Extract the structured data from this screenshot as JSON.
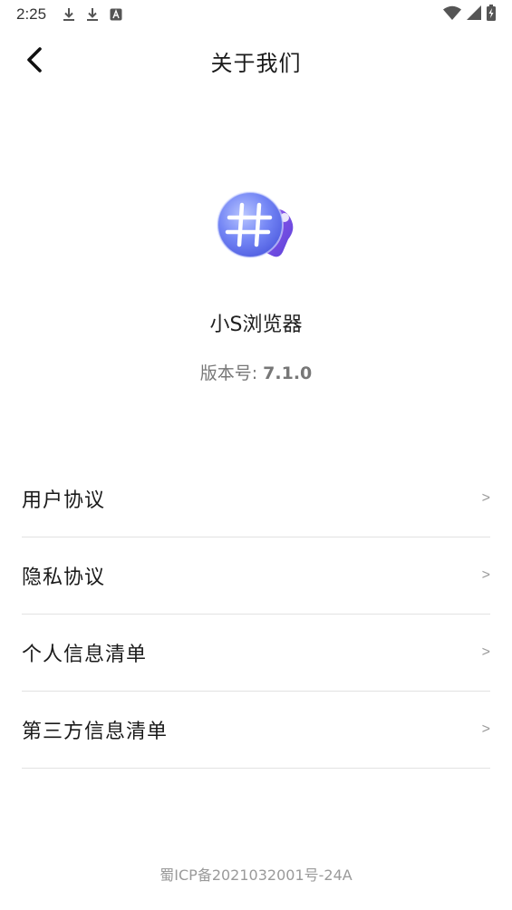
{
  "status_bar": {
    "time": "2:25",
    "left_icons": [
      "download-icon",
      "download-icon",
      "notification-a-icon"
    ],
    "right_icons": [
      "wifi-icon",
      "signal-icon",
      "battery-charging-icon"
    ]
  },
  "header": {
    "title": "关于我们",
    "back_icon": "chevron-left-icon"
  },
  "app": {
    "name": "小S浏览器",
    "version_label": "版本号: ",
    "version_number": "7.1.0",
    "logo_icon": "hash-globe-logo-icon"
  },
  "menu": {
    "items": [
      {
        "label": "用户协议",
        "chevron": ">"
      },
      {
        "label": "隐私协议",
        "chevron": ">"
      },
      {
        "label": "个人信息清单",
        "chevron": ">"
      },
      {
        "label": "第三方信息清单",
        "chevron": ">"
      }
    ]
  },
  "footer": {
    "icp": "蜀ICP备2021032001号-24A"
  },
  "colors": {
    "background": "#ffffff",
    "text_primary": "#1a1a1a",
    "text_secondary": "#777777",
    "divider": "#e2e2e2",
    "logo_blue": "#5b6cf0",
    "logo_purple": "#7a4fe0"
  }
}
